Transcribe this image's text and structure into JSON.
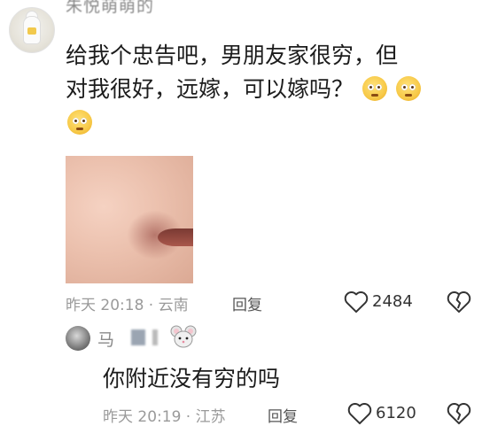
{
  "comment": {
    "username": "朱悦萌萌的",
    "text_line1": "给我个忠告吧，男朋友家很穷，但",
    "text_line2": "对我很好，远嫁，可以嫁吗？",
    "time_location": "昨天 20:18 · 云南",
    "reply_label": "回复",
    "like_count": "2484"
  },
  "reply": {
    "username_prefix": "马",
    "text": "你附近没有穷的吗",
    "time_location": "昨天 20:19 · 江苏",
    "reply_label": "回复",
    "like_count": "6120"
  },
  "icons": {
    "heart": "heart-outline-icon",
    "dislike": "broken-heart-icon",
    "emoji": "pleading-face-emoji",
    "mouse": "mouse-face-icon"
  }
}
